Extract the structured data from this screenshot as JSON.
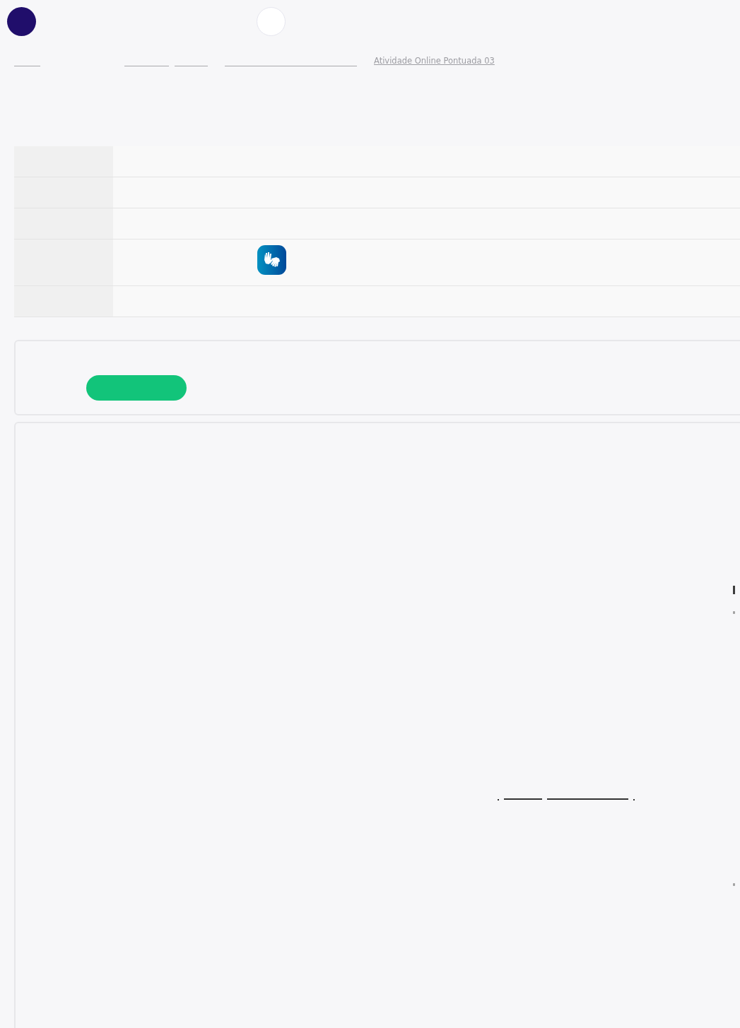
{
  "header": {
    "items": [
      {
        "kind": "logo"
      },
      {
        "kind": "round-button"
      }
    ]
  },
  "breadcrumb": [
    {
      "kind": "blank"
    },
    {
      "kind": "blank"
    },
    {
      "kind": "blank"
    },
    {
      "kind": "blank"
    },
    {
      "kind": "link",
      "label": "Atividade Online Pontuada 03"
    }
  ],
  "details_table": {
    "rows": [
      {
        "kind": "blank"
      },
      {
        "kind": "blank"
      },
      {
        "kind": "blank"
      },
      {
        "kind": "sign-language"
      },
      {
        "kind": "blank"
      }
    ]
  },
  "action_card": {
    "button": {
      "kind": "primary"
    }
  },
  "content_card": {
    "marks": [
      {
        "kind": "edge-bar"
      },
      {
        "kind": "edge-dot"
      },
      {
        "kind": "dot"
      },
      {
        "kind": "underline"
      },
      {
        "kind": "underline"
      },
      {
        "kind": "dot"
      },
      {
        "kind": "edge-dot"
      }
    ]
  }
}
